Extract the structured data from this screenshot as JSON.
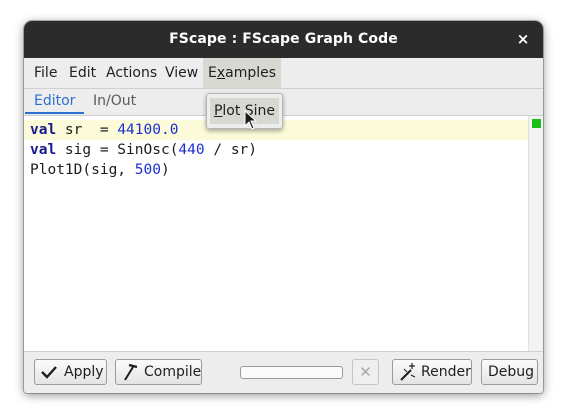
{
  "window": {
    "title": "FScape : FScape Graph Code",
    "close_glyph": "×"
  },
  "menubar": {
    "items": [
      {
        "label": "File"
      },
      {
        "label": "Edit"
      },
      {
        "label": "Actions"
      },
      {
        "label": "View"
      },
      {
        "label_pre": "E",
        "label_u": "x",
        "label_post": "amples",
        "active": true
      }
    ]
  },
  "examples_menu": {
    "items": [
      {
        "label_u": "P",
        "label_post": "lot Sine"
      }
    ]
  },
  "tabs": [
    {
      "label": "Editor",
      "selected": true
    },
    {
      "label": "In/Out",
      "selected": false
    }
  ],
  "editor": {
    "lines": [
      {
        "kw": "val",
        "a": " sr  = ",
        "num": "44100.0",
        "b": ""
      },
      {
        "kw": "val",
        "a": " sig = SinOsc(",
        "num": "440",
        "b": " / sr)"
      },
      {
        "kw": "",
        "a": "Plot1D(sig, ",
        "num": "500",
        "b": ")"
      }
    ],
    "status_color": "#19c019"
  },
  "toolbar": {
    "apply_label": "Apply",
    "apply_icon": "check-icon",
    "compile_label": "Compile",
    "compile_icon": "hammer-icon",
    "progress": 0,
    "stop_glyph": "✕",
    "render_label": "Render",
    "render_icon": "render-icon",
    "debug_label": "Debug"
  }
}
